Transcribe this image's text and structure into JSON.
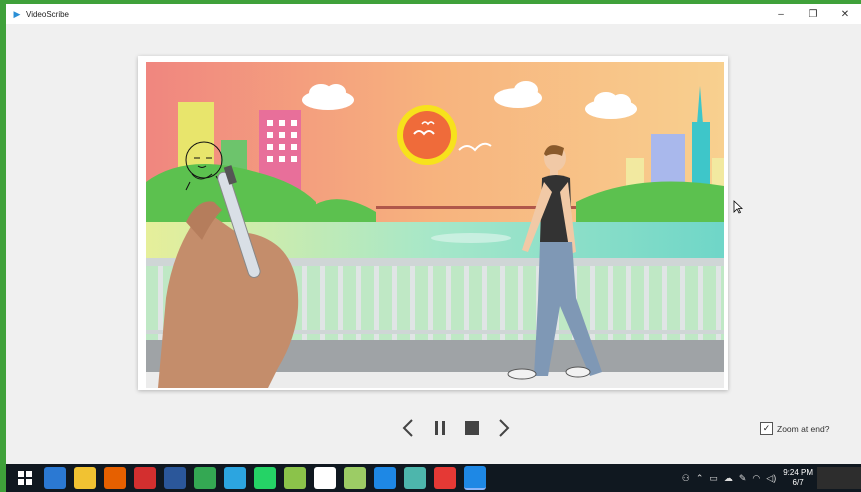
{
  "window": {
    "title": "VideoScribe",
    "app_icon": "videoscribe-icon"
  },
  "window_controls": {
    "minimize": "–",
    "restore": "❐",
    "close": "✕"
  },
  "playback": {
    "prev": "prev-icon",
    "pause": "pause-icon",
    "stop": "stop-icon",
    "next": "next-icon"
  },
  "zoom_checkbox": {
    "label": "Zoom at end?",
    "checked": true,
    "mark": "✓"
  },
  "taskbar": {
    "items": [
      {
        "name": "windows-start-icon",
        "color": "#ffffff"
      },
      {
        "name": "store-icon",
        "color": "#2b79d3"
      },
      {
        "name": "file-explorer-icon",
        "color": "#f1c232"
      },
      {
        "name": "firefox-icon",
        "color": "#e66000"
      },
      {
        "name": "pdf-app-icon",
        "color": "#d32f2f"
      },
      {
        "name": "word-icon",
        "color": "#2b579a"
      },
      {
        "name": "chrome-icon",
        "color": "#34a853"
      },
      {
        "name": "telegram-icon",
        "color": "#2ca5e0"
      },
      {
        "name": "whatsapp-icon",
        "color": "#25d366"
      },
      {
        "name": "chart-app-icon",
        "color": "#8bc34a"
      },
      {
        "name": "mail-icon",
        "color": "#ffffff"
      },
      {
        "name": "notepad-icon",
        "color": "#9ccc65"
      },
      {
        "name": "media-icon",
        "color": "#1e88e5"
      },
      {
        "name": "terminal-icon",
        "color": "#4db6ac"
      },
      {
        "name": "presenter-icon",
        "color": "#e53935"
      },
      {
        "name": "videoscribe-taskbar-icon",
        "color": "#1e88e5"
      }
    ]
  },
  "tray": {
    "time": "9:24 PM",
    "date": "6/7"
  },
  "colors": {
    "accent": "#1e88e5",
    "desktop_green": "#3fa13a",
    "taskbar": "#101820"
  }
}
